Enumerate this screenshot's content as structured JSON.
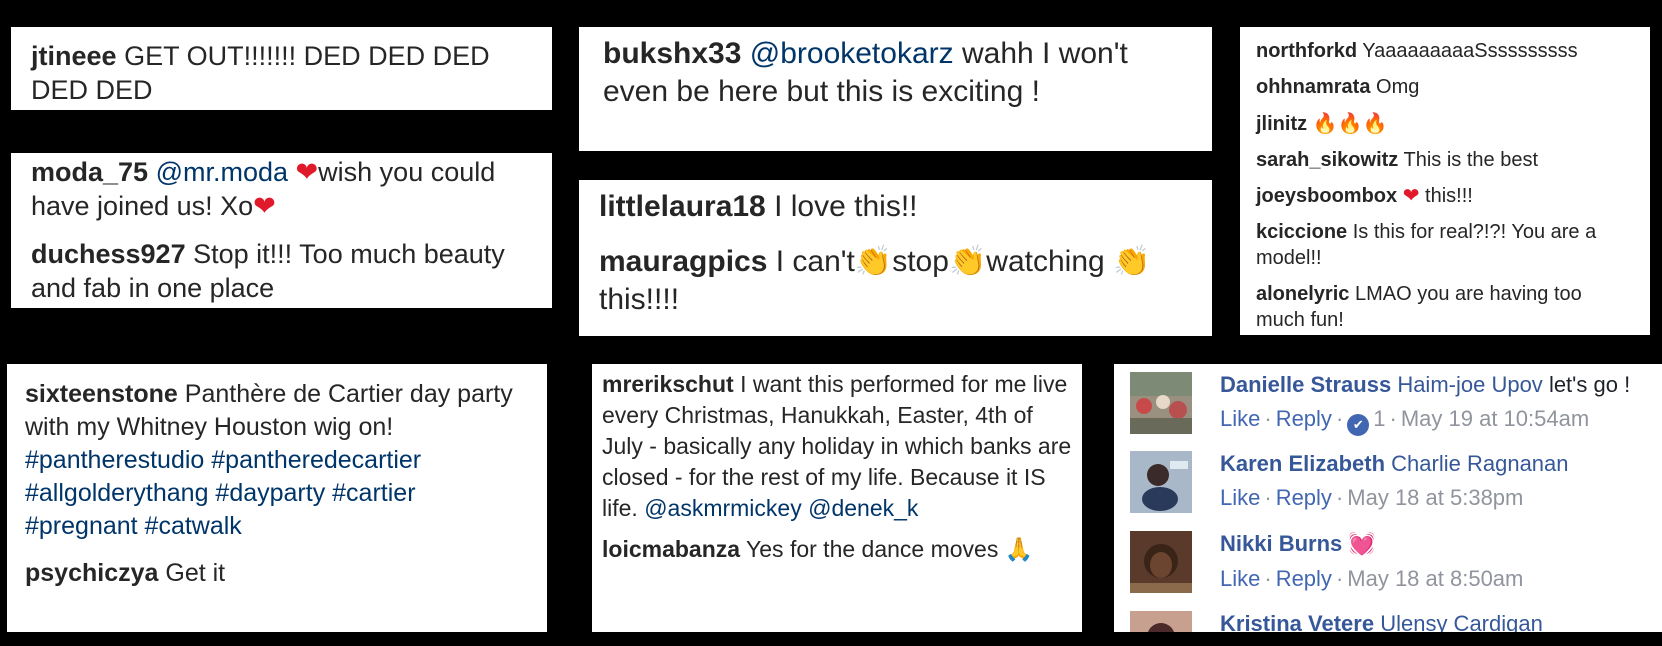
{
  "c1": {
    "user": "jtineee",
    "text": "GET OUT!!!!!!! DED DED DED DED DED"
  },
  "c2": [
    {
      "user": "moda_75",
      "mention": "@mr.moda",
      "heart": "❤",
      "text": "wish you could have joined us! Xo",
      "heart2": "❤"
    },
    {
      "user": "duchess927",
      "text": "Stop it!!! Too much beauty and fab in one place"
    }
  ],
  "c3": {
    "user": "bukshx33",
    "mention": "@brooketokarz",
    "text": "wahh I won't even be here but this is exciting !"
  },
  "c4": [
    {
      "user": "littlelaura18",
      "text": "I love this!!"
    },
    {
      "user": "mauragpics",
      "t1": "I can't",
      "clap": "👏",
      "t2": "stop",
      "t3": "watching",
      "t4": "this!!!!"
    }
  ],
  "c5": [
    {
      "user": "northforkd",
      "text": "YaaaaaaaaaSsssssssss"
    },
    {
      "user": "ohhnamrata",
      "text": "Omg"
    },
    {
      "user": "jlinitz",
      "text": "🔥🔥🔥"
    },
    {
      "user": "sarah_sikowitz",
      "text": "This is the best"
    },
    {
      "user": "joeysboombox",
      "heart": "❤",
      "text": "this!!!"
    },
    {
      "user": "kciccione",
      "text": "Is this for real?!?! You are a model!!"
    },
    {
      "user": "alonelyric",
      "text": "LMAO you are having too much fun!"
    }
  ],
  "c6": [
    {
      "user": "sixteenstone",
      "text": "Panthère de Cartier day party with my Whitney Houston wig on!",
      "tags": "#pantherestudio #pantheredecartier #allgolderythang #dayparty #cartier #pregnant #catwalk"
    },
    {
      "user": "psychiczya",
      "text": "Get it"
    }
  ],
  "c7": [
    {
      "user": "mrerikschut",
      "text": "I want this performed for me live every Christmas, Hanukkah, Easter, 4th of July - basically any holiday in which banks are closed - for the rest of my life. Because it IS life.",
      "mentions": "@askmrmickey @denek_k"
    },
    {
      "user": "loicmabanza",
      "text": "Yes for the dance moves",
      "emoji": "🙏"
    }
  ],
  "fb": {
    "like": "Like",
    "reply": "Reply",
    "sep": "·",
    "comments": [
      {
        "name": "Danielle Strauss",
        "tag": "Haim-joe Upov",
        "text": "let's go !",
        "like_count": "1",
        "time": "May 19 at 10:54am"
      },
      {
        "name": "Karen Elizabeth",
        "tag": "Charlie Ragnanan",
        "text": "",
        "time": "May 18 at 5:38pm"
      },
      {
        "name": "Nikki Burns",
        "heart": "💓",
        "time": "May 18 at 8:50am"
      },
      {
        "name": "Kristina Vetere",
        "tag": "Ulensy Cardigan"
      }
    ]
  }
}
